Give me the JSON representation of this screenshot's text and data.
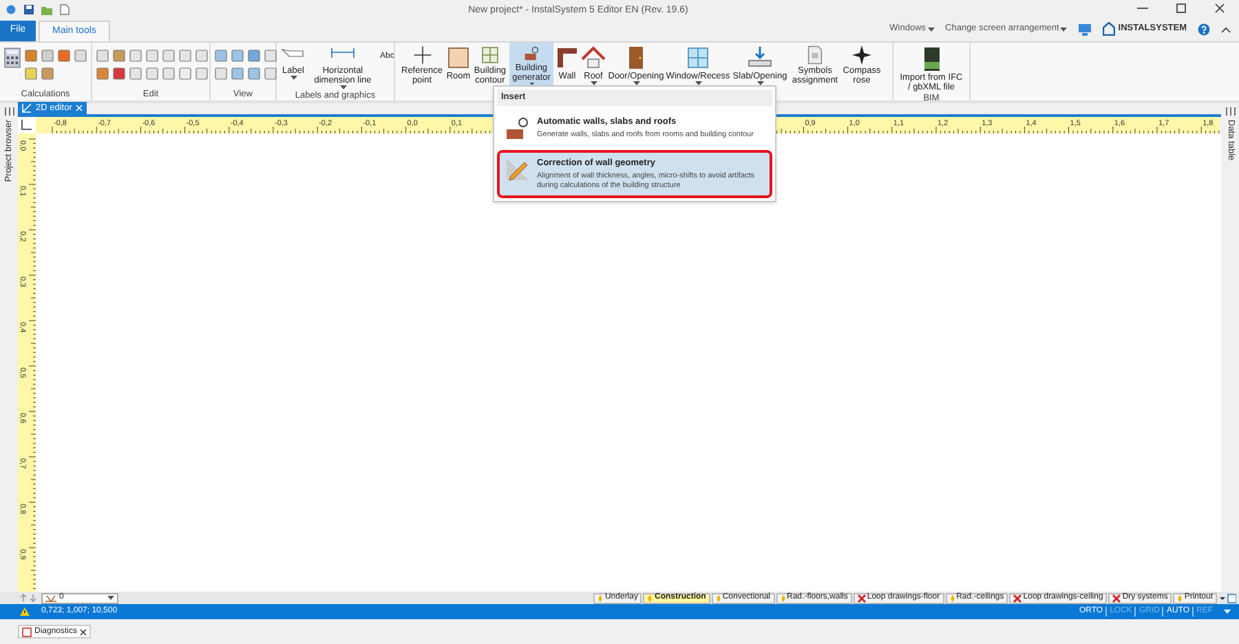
{
  "title_bar": {
    "title": "New project* - InstalSystem 5 Editor EN (Rev. 19.6)"
  },
  "ribbon_tabs": [
    {
      "label": "File",
      "kind": "file",
      "selected": false
    },
    {
      "label": "Main tools",
      "kind": "tab",
      "selected": true
    }
  ],
  "header_menus": [
    {
      "label": "Windows"
    },
    {
      "label": "Change screen arrangement"
    }
  ],
  "logo": "INSTALSYSTEM",
  "group_labels": {
    "calculations": "Calculations",
    "edit": "Edit",
    "view": "View",
    "labels": "Labels and graphics",
    "bim": "BIM"
  },
  "label_tools": [
    {
      "label": "Label",
      "menu": true
    },
    {
      "label": "Horizontal dimension line",
      "menu": true
    },
    {
      "label": "Abc",
      "menu": false
    }
  ],
  "big_buttons": [
    {
      "label": "Reference point",
      "menu": false,
      "selected": false
    },
    {
      "label": "Room",
      "menu": false,
      "selected": false
    },
    {
      "label": "Building contour",
      "menu": false,
      "selected": false
    },
    {
      "label": "Building generator",
      "menu": true,
      "selected": true
    },
    {
      "label": "Wall",
      "menu": false,
      "selected": false
    },
    {
      "label": "Roof",
      "menu": true,
      "selected": false
    },
    {
      "label": "Door/Opening",
      "menu": true,
      "selected": false
    },
    {
      "label": "Window/Recess",
      "menu": true,
      "selected": false
    },
    {
      "label": "Slab/Opening",
      "menu": true,
      "selected": false
    },
    {
      "label": "Symbols assignment",
      "menu": false,
      "selected": false
    },
    {
      "label": "Compass rose",
      "menu": false,
      "selected": false
    }
  ],
  "bim_button": {
    "label": "Import from IFC / gbXML file"
  },
  "dropdown": {
    "header": "Insert",
    "items": [
      {
        "title": "Automatic walls, slabs and roofs",
        "description": "Generate walls, slabs and roofs from rooms and building contour",
        "selected": false
      },
      {
        "title": "Correction of wall geometry",
        "description": "Alignment of wall thickness, angles, micro-shifts to avoid artifacts during calculations of the building structure",
        "selected": true
      }
    ]
  },
  "side_panels": {
    "left": "Project browser",
    "right": "Data table"
  },
  "document_tabs": [
    {
      "label": "2D editor",
      "selected": true
    }
  ],
  "ruler": {
    "horizontal": [
      "-0,8",
      "-0,7",
      "-0,6",
      "-0,5",
      "-0,4",
      "-0,3",
      "-0,2",
      "-0,1",
      "0,0",
      "0,1"
    ],
    "horizontal_after_menu": [
      "0,9",
      "1,0",
      "1,1",
      "1,2",
      "1,3",
      "1,4",
      "1,5",
      "1,6",
      "1,7",
      "1,8"
    ],
    "vertical": [
      "0,0",
      "0,1",
      "0,2",
      "0,3",
      "0,4",
      "0,5",
      "0,6",
      "0,7",
      "0,8",
      "0,9"
    ]
  },
  "layer_selector": {
    "value": "0"
  },
  "layers": [
    {
      "label": "Underlay",
      "visible": true,
      "selected": false
    },
    {
      "label": "Construction",
      "visible": true,
      "selected": true
    },
    {
      "label": "Convectional",
      "visible": true,
      "selected": false
    },
    {
      "label": "Rad.-floors,walls",
      "visible": true,
      "selected": false
    },
    {
      "label": "Loop drawings-floor",
      "visible": false,
      "selected": false
    },
    {
      "label": "Rad.-ceilings",
      "visible": true,
      "selected": false
    },
    {
      "label": "Loop drawings-ceiling",
      "visible": false,
      "selected": false
    },
    {
      "label": "Dry systems",
      "visible": false,
      "selected": false
    },
    {
      "label": "Printout",
      "visible": true,
      "selected": false
    }
  ],
  "status_bar": {
    "coordinates": "0,723; 1,007; 10,500",
    "modes": [
      {
        "label": "ORTO",
        "on": true
      },
      {
        "label": "LOCK",
        "on": false
      },
      {
        "label": "GRID",
        "on": false
      },
      {
        "label": "AUTO",
        "on": true
      },
      {
        "label": "REF",
        "on": false
      }
    ]
  },
  "bottom_tabs": [
    {
      "label": "Diagnostics"
    }
  ]
}
